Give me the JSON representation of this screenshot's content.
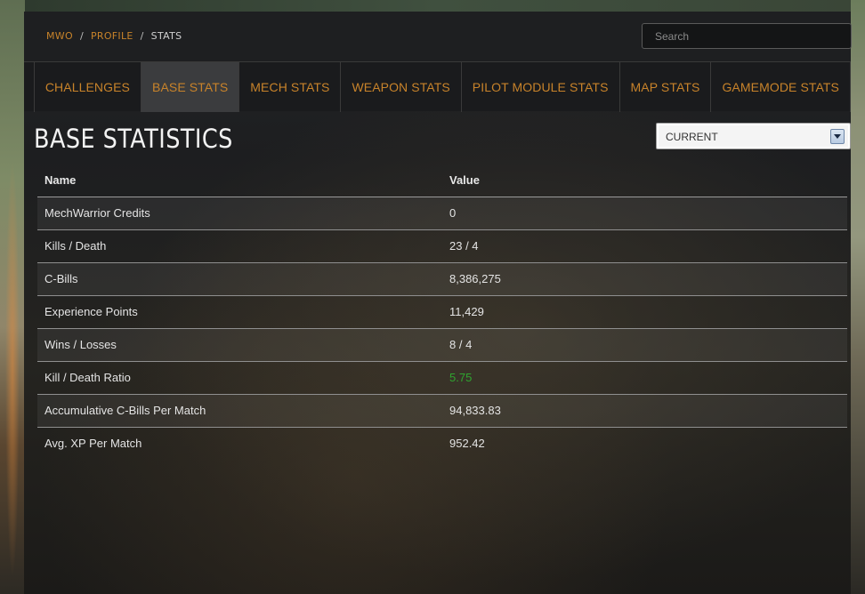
{
  "breadcrumb": {
    "items": [
      "MWO",
      "PROFILE",
      "STATS"
    ],
    "separator": "/"
  },
  "search": {
    "placeholder": "Search"
  },
  "tabs": [
    {
      "label": "CHALLENGES",
      "active": false
    },
    {
      "label": "BASE STATS",
      "active": true
    },
    {
      "label": "MECH STATS",
      "active": false
    },
    {
      "label": "WEAPON STATS",
      "active": false
    },
    {
      "label": "PILOT MODULE STATS",
      "active": false
    },
    {
      "label": "MAP STATS",
      "active": false
    },
    {
      "label": "GAMEMODE STATS",
      "active": false
    }
  ],
  "page": {
    "title": "BASE STATISTICS"
  },
  "period_select": {
    "selected": "CURRENT"
  },
  "table": {
    "headers": {
      "name": "Name",
      "value": "Value"
    },
    "rows": [
      {
        "name": "MechWarrior Credits",
        "value": "0"
      },
      {
        "name": "Kills / Death",
        "value": "23 / 4"
      },
      {
        "name": "C-Bills",
        "value": "8,386,275"
      },
      {
        "name": "Experience Points",
        "value": "11,429"
      },
      {
        "name": "Wins / Losses",
        "value": "8 / 4"
      },
      {
        "name": "Kill / Death Ratio",
        "value": "5.75",
        "value_color": "#2fa42f"
      },
      {
        "name": "Accumulative C-Bills Per Match",
        "value": "94,833.83"
      },
      {
        "name": "Avg. XP Per Match",
        "value": "952.42"
      }
    ]
  },
  "colors": {
    "accent": "#c8832a",
    "positive": "#2fa42f",
    "active_tab_bg": "#3b3c3e"
  },
  "icons": {
    "select_arrow": "chevron-down-icon"
  }
}
